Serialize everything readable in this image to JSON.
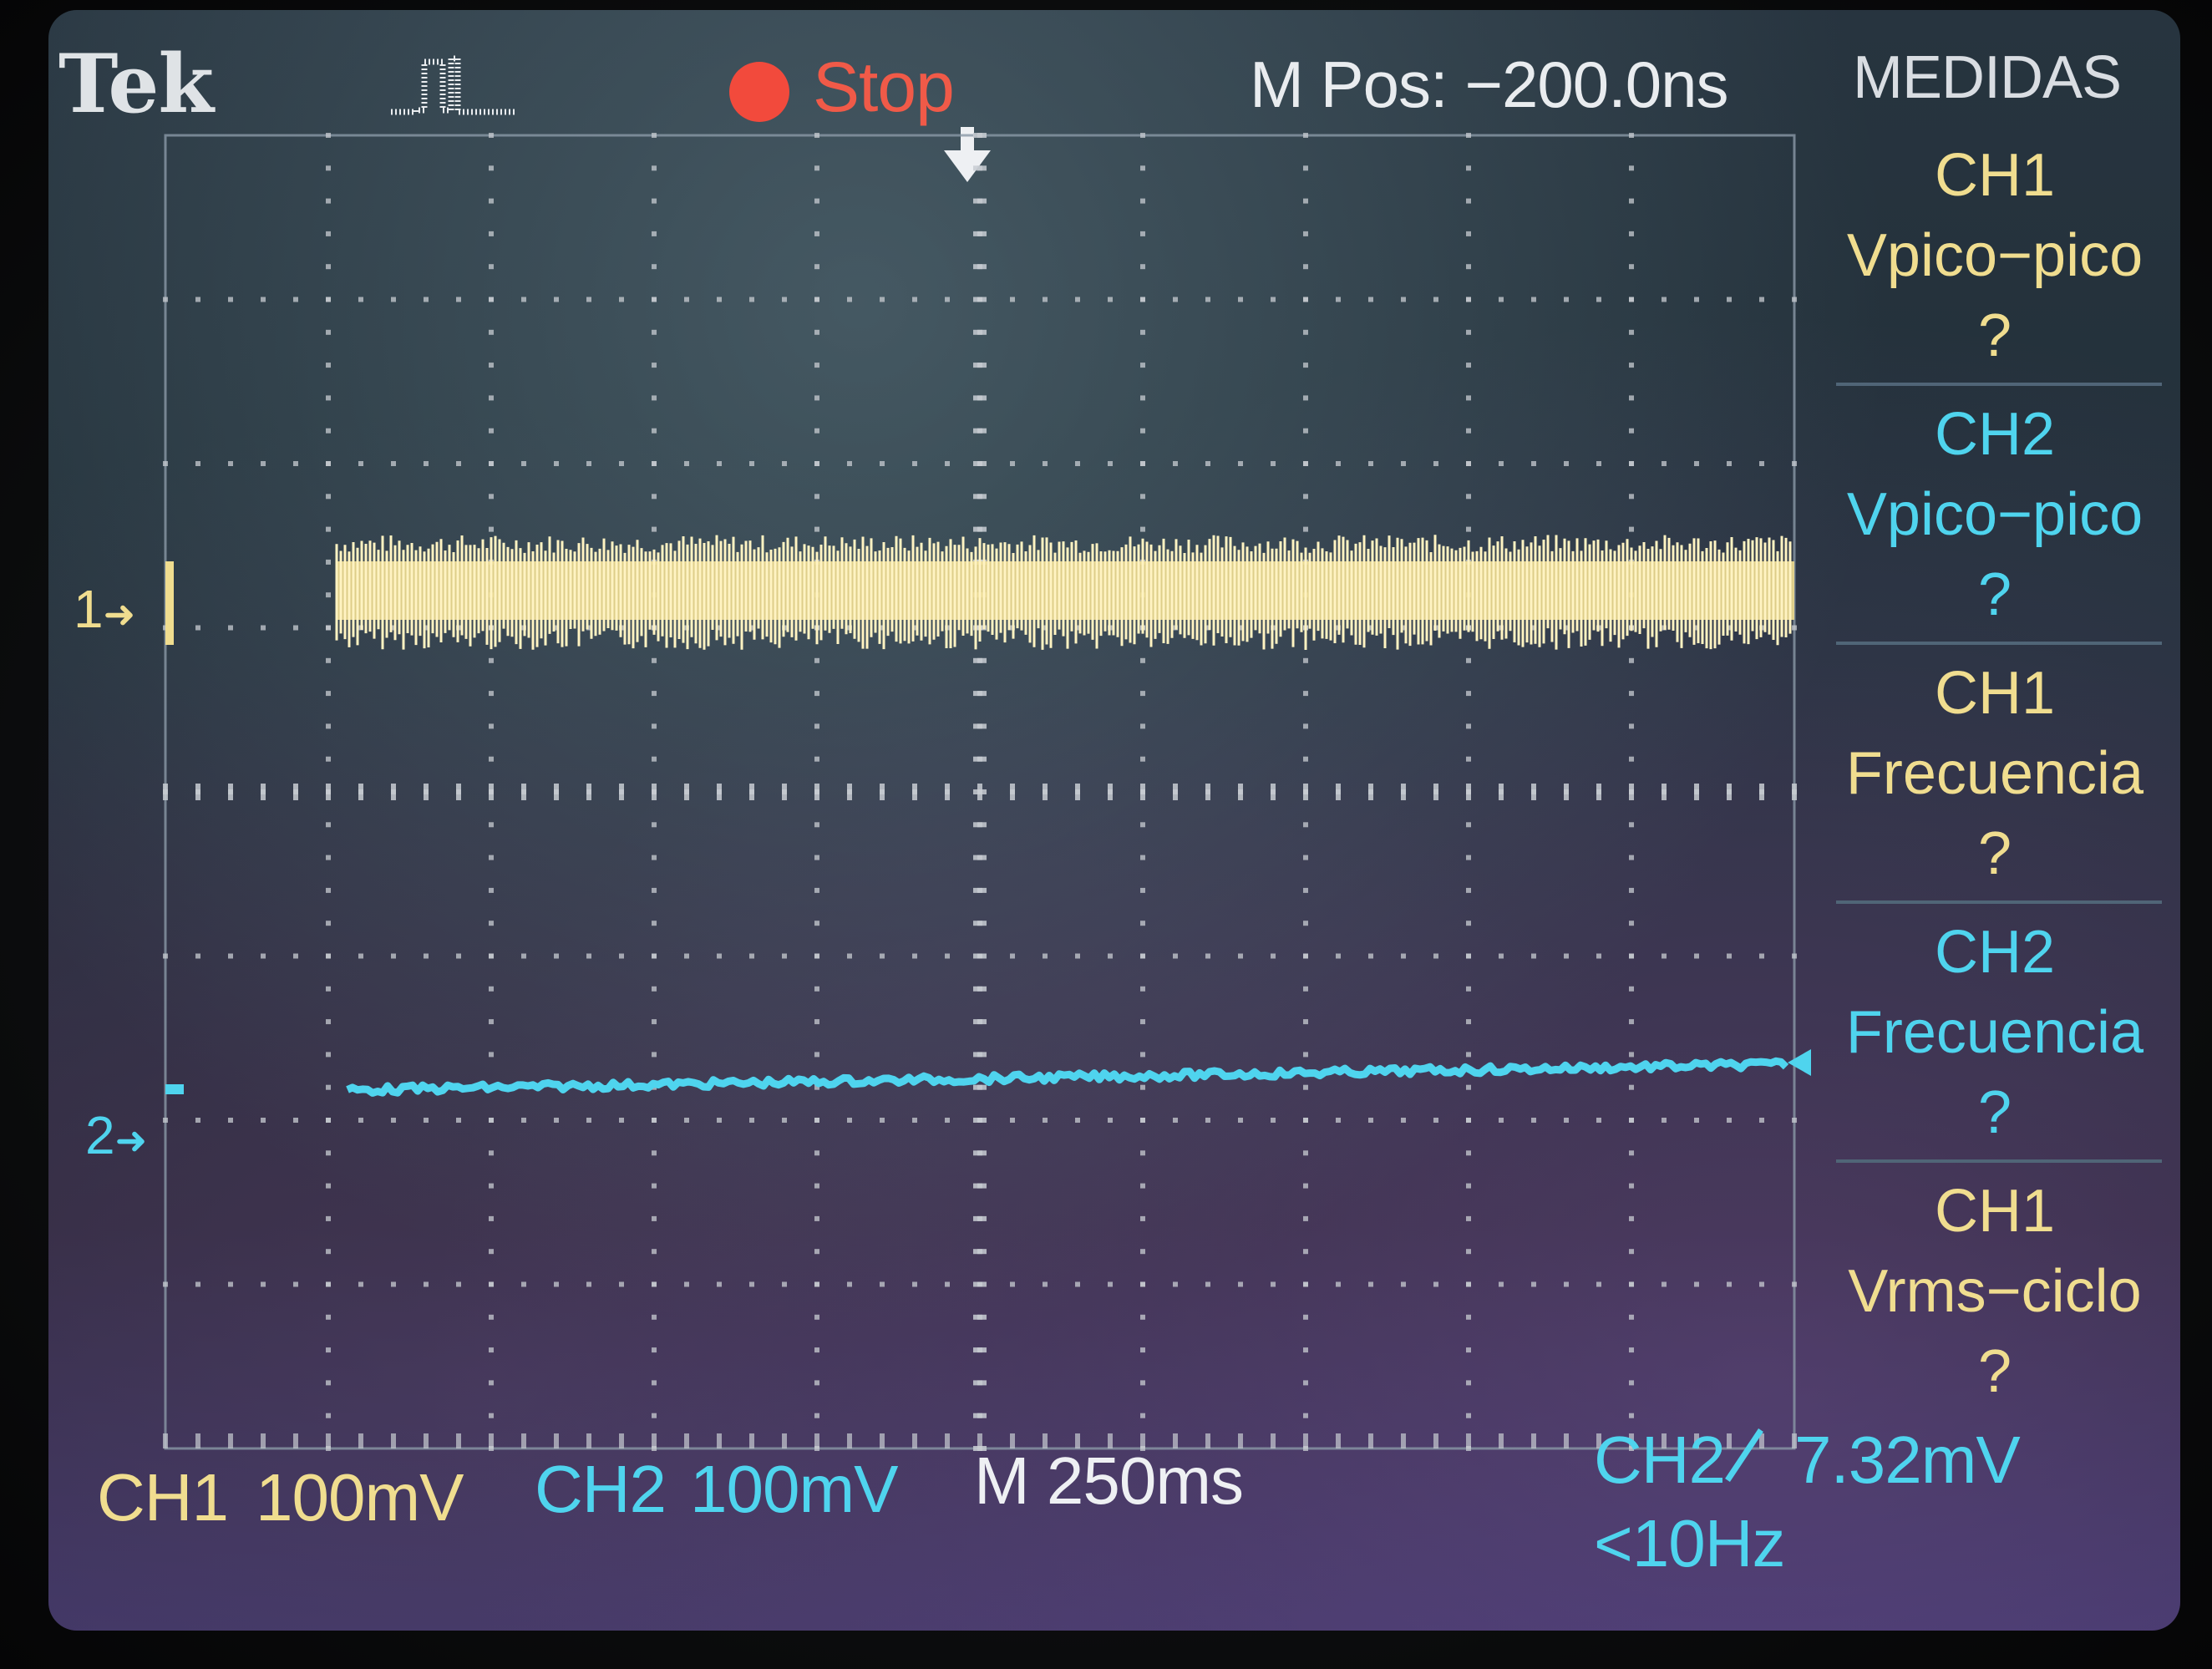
{
  "header": {
    "brand": "Tek",
    "acquisition_icon": "pulse-acquire-icon",
    "run_state": "Stop",
    "run_state_color": "#f24a3c",
    "horizontal_position": "M Pos: −200.0ns",
    "menu_title": "MEDIDAS"
  },
  "measurements": [
    {
      "channel": "CH1",
      "type": "Vpico−pico",
      "value": "?",
      "color": "#f0dd8f"
    },
    {
      "channel": "CH2",
      "type": "Vpico−pico",
      "value": "?",
      "color": "#4fd4ee"
    },
    {
      "channel": "CH1",
      "type": "Frecuencia",
      "value": "?",
      "color": "#f0dd8f"
    },
    {
      "channel": "CH2",
      "type": "Frecuencia",
      "value": "?",
      "color": "#4fd4ee"
    },
    {
      "channel": "CH1",
      "type": "Vrms−ciclo",
      "value": "?",
      "color": "#f0dd8f"
    }
  ],
  "markers": {
    "ch1": "1",
    "ch2": "2"
  },
  "footer": {
    "ch1_label": "CH1",
    "ch1_scale": "100mV",
    "ch2_label": "CH2",
    "ch2_scale": "100mV",
    "timebase": "M 250ms",
    "trigger_source": "CH2",
    "trigger_slope_icon": "rising-edge-icon",
    "trigger_level": "7.32mV",
    "trigger_frequency": "<10Hz"
  },
  "colors": {
    "ch1": "#f0dd8f",
    "ch2": "#4fd4ee",
    "grid": "#c8ccd2"
  }
}
